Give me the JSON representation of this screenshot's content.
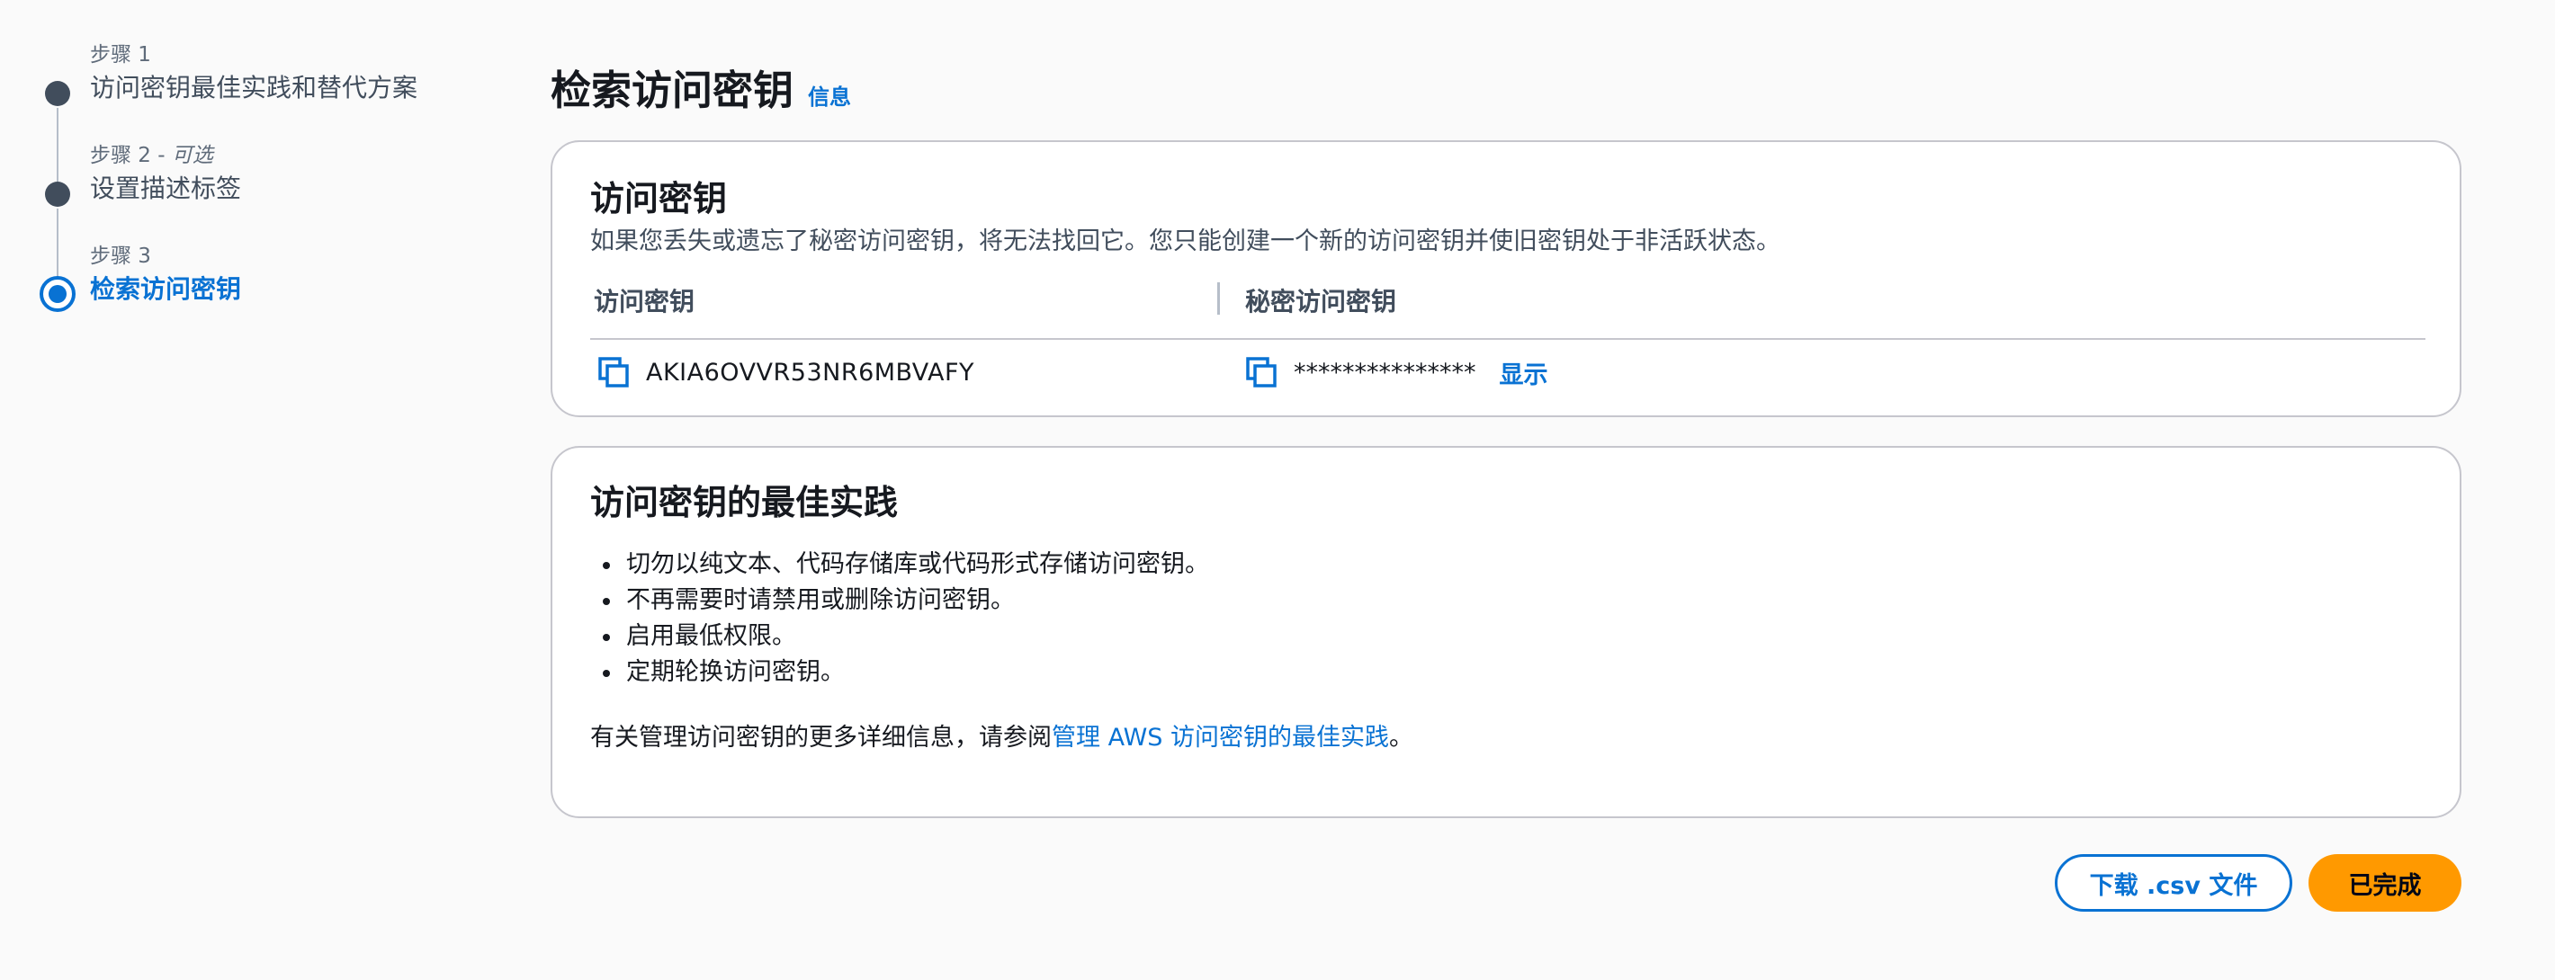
{
  "wizard": {
    "steps": [
      {
        "caption": "步骤 1",
        "title": "访问密钥最佳实践和替代方案"
      },
      {
        "caption": "步骤 2",
        "caption_sep": " - ",
        "optional": "可选",
        "title": "设置描述标签"
      },
      {
        "caption": "步骤 3",
        "title": "检索访问密钥"
      }
    ]
  },
  "header": {
    "title": "检索访问密钥",
    "info_link": "信息"
  },
  "access_key_card": {
    "title": "访问密钥",
    "description": "如果您丢失或遗忘了秘密访问密钥，将无法找回它。您只能创建一个新的访问密钥并使旧密钥处于非活跃状态。",
    "columns": [
      "访问密钥",
      "秘密访问密钥"
    ],
    "row": {
      "access_key": "AKIA6OVVR53NR6MBVAFY",
      "secret_masked": "***************",
      "show_label": "显示"
    }
  },
  "best_practices_card": {
    "title": "访问密钥的最佳实践",
    "items": [
      "切勿以纯文本、代码存储库或代码形式存储访问密钥。",
      "不再需要时请禁用或删除访问密钥。",
      "启用最低权限。",
      "定期轮换访问密钥。"
    ],
    "more_info_prefix": "有关管理访问密钥的更多详细信息，请参阅",
    "more_info_link": "管理 AWS 访问密钥的最佳实践",
    "more_info_suffix": "。"
  },
  "footer": {
    "download_label": "下载 .csv 文件",
    "done_label": "已完成"
  },
  "colors": {
    "link": "#0972d3",
    "primary_button": "#ff9900",
    "step_inactive": "#414d5c",
    "border": "#c6c6cd"
  }
}
